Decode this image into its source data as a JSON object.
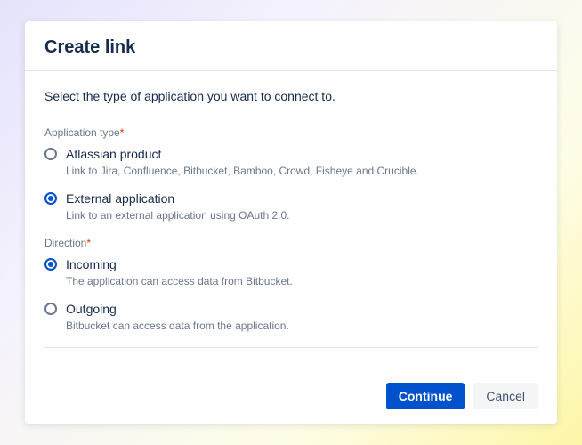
{
  "dialog": {
    "title": "Create link",
    "intro": "Select the type of application you want to connect to."
  },
  "fields": {
    "app_type": {
      "label": "Application type",
      "required": "*",
      "options": [
        {
          "label": "Atlassian product",
          "description": "Link to Jira, Confluence, Bitbucket, Bamboo, Crowd, Fisheye and Crucible.",
          "selected": false
        },
        {
          "label": "External application",
          "description": "Link to an external application using OAuth 2.0.",
          "selected": true
        }
      ]
    },
    "direction": {
      "label": "Direction",
      "required": "*",
      "options": [
        {
          "label": "Incoming",
          "description": "The application can access data from Bitbucket.",
          "selected": true
        },
        {
          "label": "Outgoing",
          "description": "Bitbucket can access data from the application.",
          "selected": false
        }
      ]
    }
  },
  "buttons": {
    "continue": "Continue",
    "cancel": "Cancel"
  }
}
